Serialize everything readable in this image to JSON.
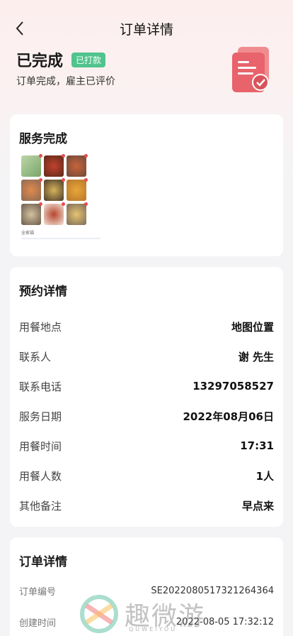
{
  "header": {
    "title": "订单详情"
  },
  "status": {
    "title": "已完成",
    "badge": "已打款",
    "desc": "订单完成，雇主已评价"
  },
  "service": {
    "title": "服务完成",
    "thumb_caption": "全家福"
  },
  "booking": {
    "title": "预约详情",
    "rows": [
      {
        "label": "用餐地点",
        "value": "地图位置"
      },
      {
        "label": "联系人",
        "value": "谢 先生"
      },
      {
        "label": "联系电话",
        "value": "13297058527"
      },
      {
        "label": "服务日期",
        "value": "2022年08月06日"
      },
      {
        "label": "用餐时间",
        "value": "17:31"
      },
      {
        "label": "用餐人数",
        "value": "1人"
      },
      {
        "label": "其他备注",
        "value": "早点来"
      }
    ]
  },
  "order": {
    "title": "订单详情",
    "rows": [
      {
        "label": "订单编号",
        "value": "SE2022080517321264364"
      },
      {
        "label": "创建时间",
        "value": "2022-08-05 17:32:12"
      }
    ]
  },
  "watermark": {
    "text": "趣微游",
    "sub": "QUWEIYOU"
  },
  "colors": {
    "badge": "#4fc48c",
    "accent": "#e8636b",
    "background": "#f4f4f6"
  }
}
